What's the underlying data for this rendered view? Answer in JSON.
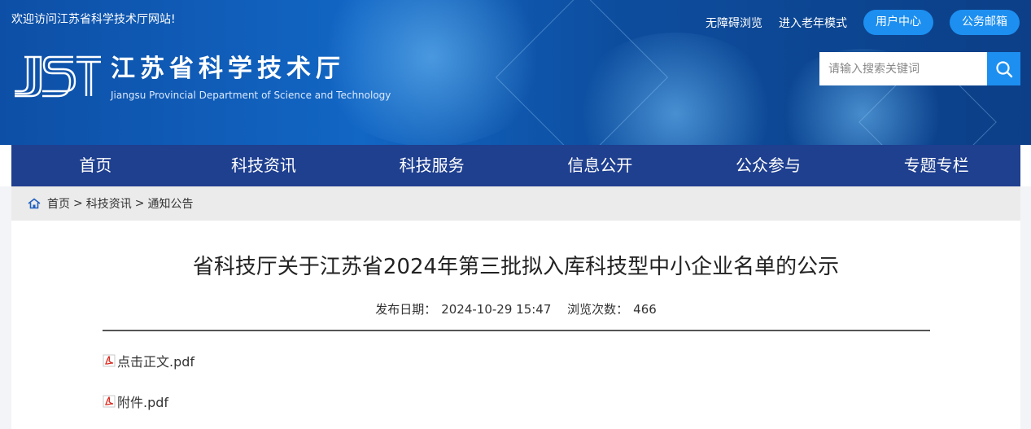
{
  "header": {
    "welcome": "欢迎访问江苏省科学技术厅网站!",
    "links": [
      "无障碍浏览",
      "进入老年模式"
    ],
    "pills": [
      "用户中心",
      "公务邮箱"
    ],
    "logo_cn": "江苏省科学技术厅",
    "logo_en": "Jiangsu Provincial Department of Science and Technology",
    "search_placeholder": "请输入搜索关键词"
  },
  "nav": {
    "items": [
      "首页",
      "科技资讯",
      "科技服务",
      "信息公开",
      "公众参与",
      "专题专栏"
    ]
  },
  "breadcrumb": {
    "items": [
      "首页",
      "科技资讯",
      "通知公告"
    ],
    "separator": ">"
  },
  "article": {
    "title": "省科技厅关于江苏省2024年第三批拟入库科技型中小企业名单的公示",
    "date_label": "发布日期：",
    "date": "2024-10-29 15:47",
    "views_label": "浏览次数：",
    "views": "466",
    "attachments": [
      "点击正文.pdf",
      "附件.pdf"
    ]
  },
  "colors": {
    "banner": "#1266c4",
    "nav": "#1f3f8f",
    "accent": "#1d8ff0",
    "pdf": "#d9261c"
  },
  "icons": {
    "search": "search-icon",
    "home": "home-icon",
    "pdf": "pdf-icon"
  }
}
